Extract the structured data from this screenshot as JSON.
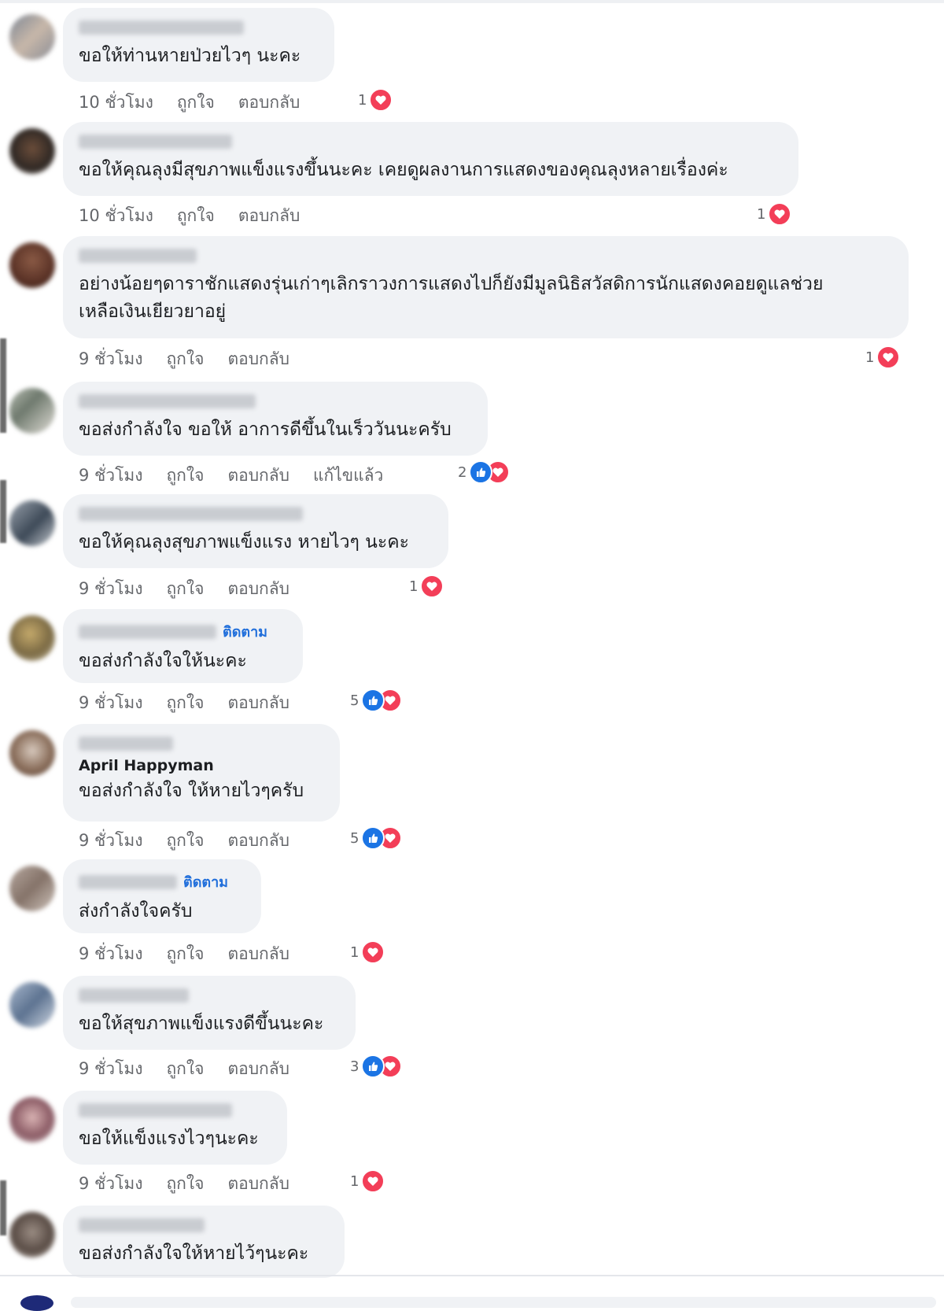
{
  "actions": {
    "like": "ถูกใจ",
    "reply": "ตอบกลับ",
    "edited": "แก้ไขแล้ว",
    "follow": "ติดตาม"
  },
  "colors": {
    "bubble": "#f0f2f5",
    "like": "#1b74e4",
    "love": "#f33e58",
    "follow": "#216fdb",
    "meta": "#65676b"
  },
  "comments": [
    {
      "text": "ขอให้ท่านหายป่วยไวๆ นะคะ",
      "time": "10 ชั่วโมง",
      "count": "1",
      "reactions": [
        "love"
      ]
    },
    {
      "text": "ขอให้คุณลุงมีสุขภาพแข็งแรงขึ้นนะคะ เคยดูผลงานการแสดงของคุณลุงหลายเรื่องค่ะ",
      "time": "10 ชั่วโมง",
      "count": "1",
      "reactions": [
        "love"
      ]
    },
    {
      "text": "อย่างน้อยๆดาราชักแสดงรุ่นเก่าๆเลิกราวงการแสดงไปก็ยังมีมูลนิธิสวัสดิการนักแสดงคอยดูแลช่วย\nเหลือเงินเยียวยาอยู่",
      "time": "9 ชั่วโมง",
      "count": "1",
      "reactions": [
        "love"
      ]
    },
    {
      "text": "ขอส่งกำลังใจ ขอให้ อาการดีขึ้นในเร็ววันนะครับ",
      "time": "9 ชั่วโมง",
      "count": "2",
      "edited": true,
      "reactions": [
        "like",
        "love"
      ]
    },
    {
      "text": "ขอให้คุณลุงสุขภาพแข็งแรง หายไวๆ นะคะ",
      "time": "9 ชั่วโมง",
      "count": "1",
      "reactions": [
        "love"
      ]
    },
    {
      "text": "ขอส่งกำลังใจให้นะคะ",
      "time": "9 ชั่วโมง",
      "count": "5",
      "follow": true,
      "reactions": [
        "like",
        "love"
      ]
    },
    {
      "author": "April Happyman",
      "text": "ขอส่งกำลังใจ ให้หายไวๆครับ",
      "time": "9 ชั่วโมง",
      "count": "5",
      "reactions": [
        "like",
        "love"
      ]
    },
    {
      "text": "ส่งกำลังใจครับ",
      "time": "9 ชั่วโมง",
      "count": "1",
      "follow": true,
      "reactions": [
        "love"
      ]
    },
    {
      "text": "ขอให้สุขภาพแข็งแรงดีขึ้นนะคะ",
      "time": "9 ชั่วโมง",
      "count": "3",
      "reactions": [
        "like",
        "love"
      ]
    },
    {
      "text": "ขอให้แข็งแรงไวๆนะคะ",
      "time": "9 ชั่วโมง",
      "count": "1",
      "reactions": [
        "love"
      ]
    },
    {
      "text": "ขอส่งกำลังใจให้หายไว้ๆนะคะ"
    }
  ]
}
